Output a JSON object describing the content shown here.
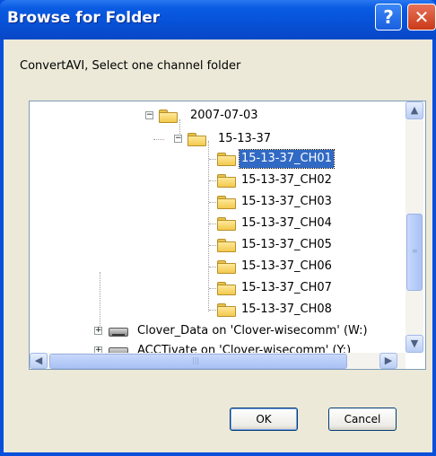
{
  "window": {
    "title": "Browse for Folder",
    "help_glyph": "?",
    "close_glyph": "✕"
  },
  "instruction": "ConvertAVI, Select one channel folder",
  "tree": {
    "items": [
      {
        "label": "2007-07-03",
        "icon": "folder-open-icon",
        "expanded": true
      },
      {
        "label": "15-13-37",
        "icon": "folder-open-icon",
        "expanded": true
      },
      {
        "label": "15-13-37_CH01",
        "icon": "folder-icon",
        "selected": true
      },
      {
        "label": "15-13-37_CH02",
        "icon": "folder-icon"
      },
      {
        "label": "15-13-37_CH03",
        "icon": "folder-icon"
      },
      {
        "label": "15-13-37_CH04",
        "icon": "folder-icon"
      },
      {
        "label": "15-13-37_CH05",
        "icon": "folder-icon"
      },
      {
        "label": "15-13-37_CH06",
        "icon": "folder-icon"
      },
      {
        "label": "15-13-37_CH07",
        "icon": "folder-icon"
      },
      {
        "label": "15-13-37_CH08",
        "icon": "folder-icon"
      },
      {
        "label": "Clover_Data on 'Clover-wisecomm' (W:)",
        "icon": "network-drive-icon"
      },
      {
        "label": "ACCTivate on 'Clover-wisecomm' (Y:)",
        "icon": "network-drive-icon"
      }
    ]
  },
  "scrollbar": {
    "up": "▲",
    "down": "▼",
    "left": "◀",
    "right": "▶"
  },
  "buttons": {
    "ok": "OK",
    "cancel": "Cancel"
  },
  "colors": {
    "title_bar": "#0752d8",
    "selection": "#316ac5",
    "dialog_bg": "#ece9d8"
  }
}
